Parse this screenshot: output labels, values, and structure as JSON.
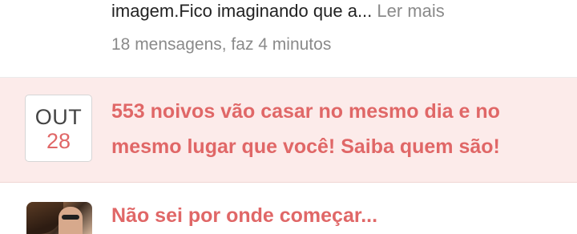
{
  "previous_item": {
    "excerpt": "imagem.Fico imaginando que a...",
    "read_more": "Ler mais",
    "meta": "18 mensagens, faz 4 minutos"
  },
  "featured_item": {
    "date_month": "OUT",
    "date_day": "28",
    "title": "553 noivos vão casar no mesmo dia e no mesmo lugar que você! Saiba quem são!"
  },
  "next_item": {
    "title": "Não sei por onde começar..."
  },
  "colors": {
    "accent": "#e06767",
    "featured_background": "#fcebea",
    "muted_text": "#8a8a8a"
  }
}
